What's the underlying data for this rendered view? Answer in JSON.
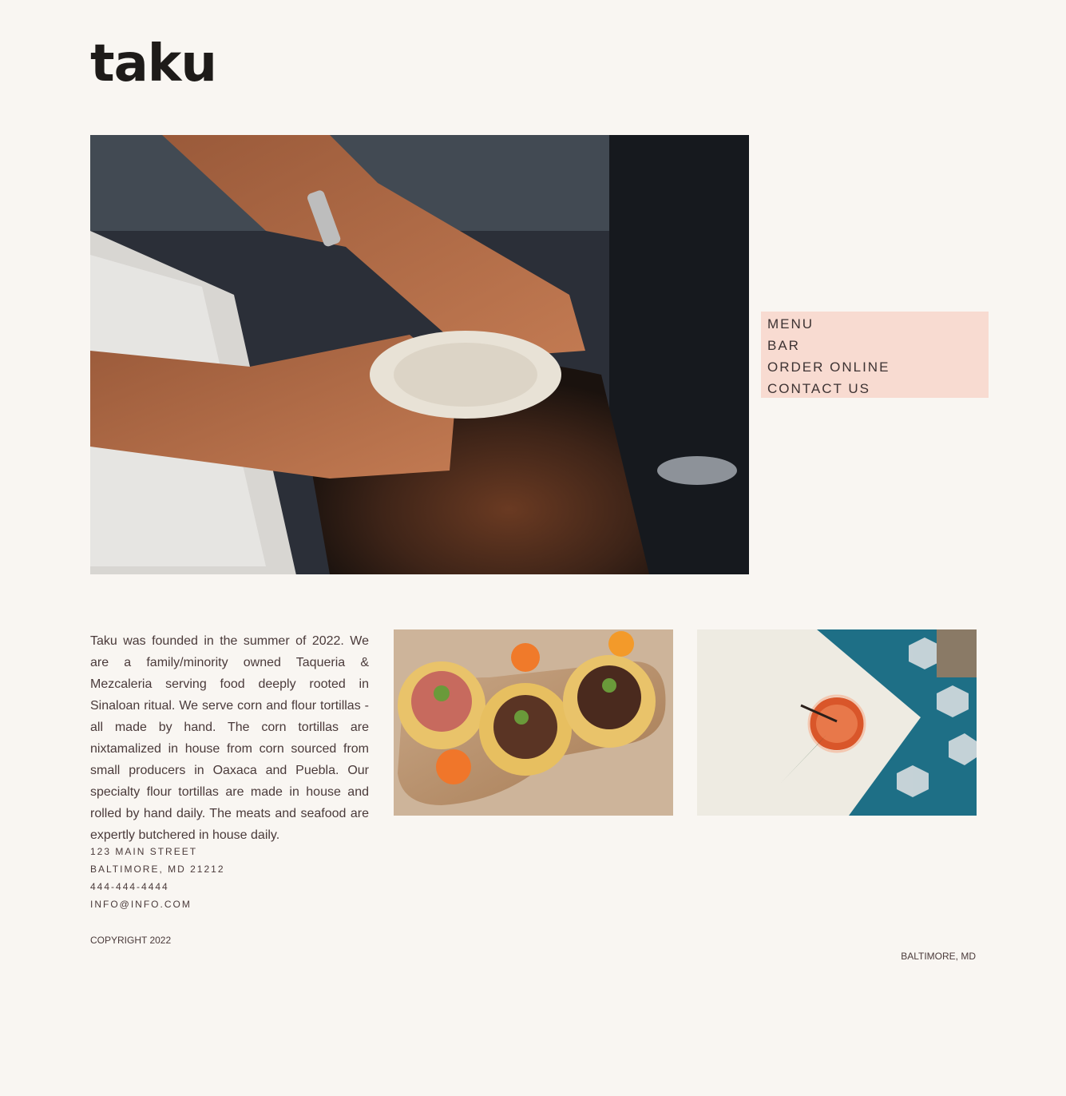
{
  "brand": {
    "logo_text": "taku"
  },
  "nav": {
    "items": [
      {
        "label": "MENU"
      },
      {
        "label": "BAR"
      },
      {
        "label": "ORDER ONLINE"
      },
      {
        "label": "CONTACT US"
      }
    ]
  },
  "about": {
    "text": "Taku was founded in the summer of 2022. We are a family/minority owned Taqueria & Mezcaleria serving food deeply rooted in Sinaloan ritual. We serve corn and flour tortillas - all made by hand. The corn tortillas are nixtamalized in house from corn sourced from small producers in Oaxaca and Puebla. Our specialty flour tortillas are made in house and rolled by hand daily. The meats and seafood are expertly butchered in house daily."
  },
  "contact": {
    "street": "123 MAIN STREET",
    "city": "BALTIMORE, MD 21212",
    "phone": "444-444-4444",
    "email": "INFO@INFO.COM"
  },
  "footer": {
    "copyright": "COPYRIGHT 2022",
    "location": "BALTIMORE, MD"
  },
  "colors": {
    "background": "#f9f6f2",
    "nav_highlight": "#f8dbd1",
    "text": "#4a3a3a",
    "logo": "#1e1b19"
  }
}
